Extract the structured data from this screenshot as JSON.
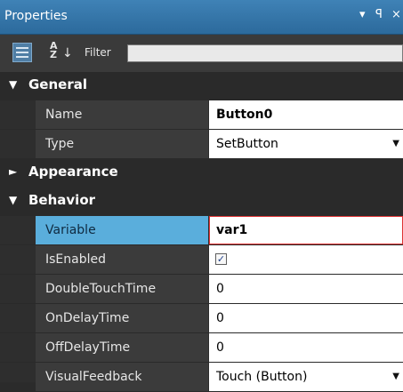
{
  "panel": {
    "title": "Properties",
    "pin_glyph": "▾ ꟼ ×"
  },
  "toolbar": {
    "sort_glyph": "A↓Z",
    "filter_label": "Filter",
    "filter_value": ""
  },
  "categories": {
    "general": {
      "label": "General",
      "expanded": true
    },
    "appearance": {
      "label": "Appearance",
      "expanded": false
    },
    "behavior": {
      "label": "Behavior",
      "expanded": true
    }
  },
  "properties": {
    "name": {
      "label": "Name",
      "value": "Button0"
    },
    "type": {
      "label": "Type",
      "value": "SetButton"
    },
    "variable": {
      "label": "Variable",
      "value": "var1"
    },
    "is_enabled": {
      "label": "IsEnabled",
      "checked": true
    },
    "double_touch_time": {
      "label": "DoubleTouchTime",
      "value": "0"
    },
    "on_delay_time": {
      "label": "OnDelayTime",
      "value": "0"
    },
    "off_delay_time": {
      "label": "OffDelayTime",
      "value": "0"
    },
    "visual_feedback": {
      "label": "VisualFeedback",
      "value": "Touch (Button)"
    }
  },
  "colors": {
    "title_bar": "#3579ac",
    "selected_row": "#5aaedc",
    "focus_border": "#dd3333"
  }
}
